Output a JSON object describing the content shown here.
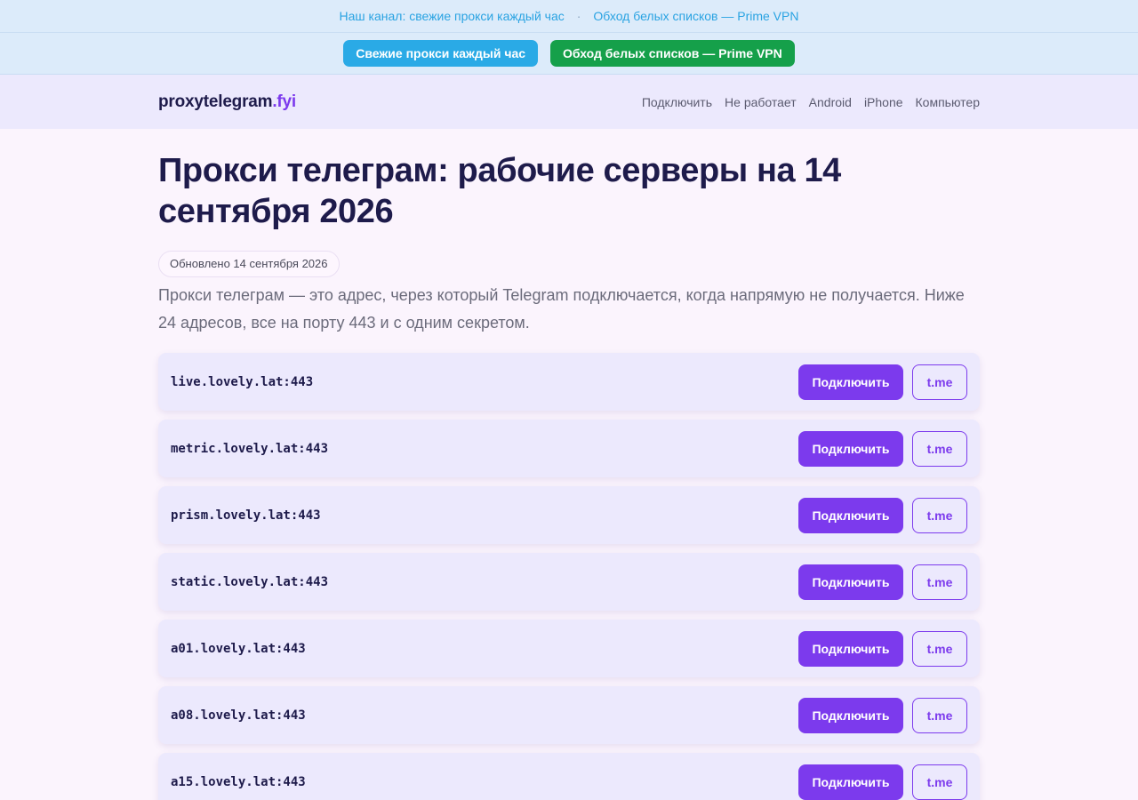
{
  "topbar": {
    "channel_link": "Наш канал: свежие прокси каждый час",
    "separator": "·",
    "vpn_link": "Обход белых списков — Prime VPN"
  },
  "cta": {
    "fresh_label": "Свежие прокси каждый час",
    "vpn_label": "Обход белых списков — Prime VPN"
  },
  "header": {
    "logo_main": "proxytelegram",
    "logo_tld": ".fyi",
    "nav": [
      "Подключить",
      "Не работает",
      "Android",
      "iPhone",
      "Компьютер"
    ]
  },
  "main": {
    "title": "Прокси телеграм: рабочие серверы на 14 сентября 2026",
    "updated": "Обновлено 14 сентября 2026",
    "lead": "Прокси телеграм — это адрес, через который Telegram подключается, когда напрямую не получается. Ниже 24 адресов, все на порту 443 и с одним секретом."
  },
  "proxies": {
    "connect_label": "Подключить",
    "tme_label": "t.me",
    "items": [
      "live.lovely.lat:443",
      "metric.lovely.lat:443",
      "prism.lovely.lat:443",
      "static.lovely.lat:443",
      "a01.lovely.lat:443",
      "a08.lovely.lat:443",
      "a15.lovely.lat:443"
    ]
  },
  "colors": {
    "accent": "#7c3aed",
    "topbar_link": "#2aa3e2",
    "cta_blue": "#2aaae6",
    "cta_green": "#15a04a",
    "title": "#1e1b4b"
  }
}
